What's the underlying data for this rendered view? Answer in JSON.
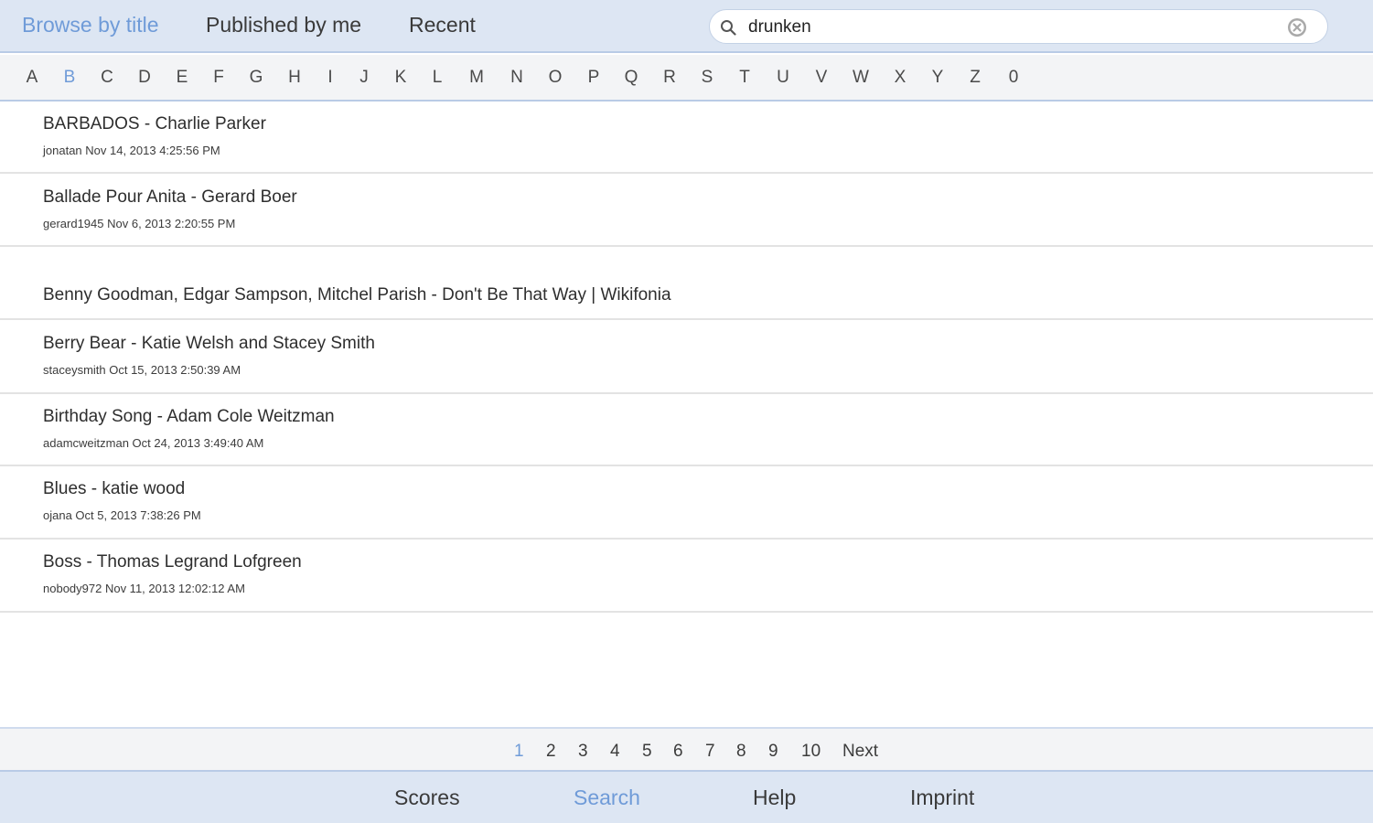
{
  "tabs": {
    "browse_by_title": "Browse by title",
    "published_by_me": "Published by me",
    "recent": "Recent"
  },
  "search": {
    "value": "drunken",
    "icon": "search-icon",
    "clear_icon": "clear-icon"
  },
  "alphabet": {
    "letters": [
      "A",
      "B",
      "C",
      "D",
      "E",
      "F",
      "G",
      "H",
      "I",
      "J",
      "K",
      "L",
      "M",
      "N",
      "O",
      "P",
      "Q",
      "R",
      "S",
      "T",
      "U",
      "V",
      "W",
      "X",
      "Y",
      "Z",
      "0"
    ],
    "selected": "B"
  },
  "scores": [
    {
      "title": "BARBADOS - Charlie Parker",
      "meta": "jonatan Nov 14, 2013 4:25:56 PM"
    },
    {
      "title": "Ballade Pour Anita - Gerard Boer",
      "meta": "gerard1945 Nov 6, 2013 2:20:55 PM"
    },
    {
      "title": "Benny Goodman, Edgar Sampson, Mitchel Parish - Don't Be That Way | Wikifonia",
      "meta": ""
    },
    {
      "title": "Berry Bear - Katie Welsh and Stacey Smith",
      "meta": "staceysmith Oct 15, 2013 2:50:39 AM"
    },
    {
      "title": "Birthday Song - Adam Cole Weitzman",
      "meta": "adamcweitzman Oct 24, 2013 3:49:40 AM"
    },
    {
      "title": "Blues - katie wood",
      "meta": "ojana Oct 5, 2013 7:38:26 PM"
    },
    {
      "title": "Boss - Thomas Legrand Lofgreen",
      "meta": "nobody972 Nov 11, 2013 12:02:12 AM"
    }
  ],
  "pagination": {
    "pages": [
      "1",
      "2",
      "3",
      "4",
      "5",
      "6",
      "7",
      "8",
      "9",
      "10"
    ],
    "current": "1",
    "next": "Next"
  },
  "bottom_nav": {
    "scores": "Scores",
    "search": "Search",
    "help": "Help",
    "imprint": "Imprint",
    "active": "search"
  },
  "colors": {
    "accent": "#6f9bd8",
    "bar_background": "#dde6f3",
    "bar_border": "#b9cbe6"
  }
}
